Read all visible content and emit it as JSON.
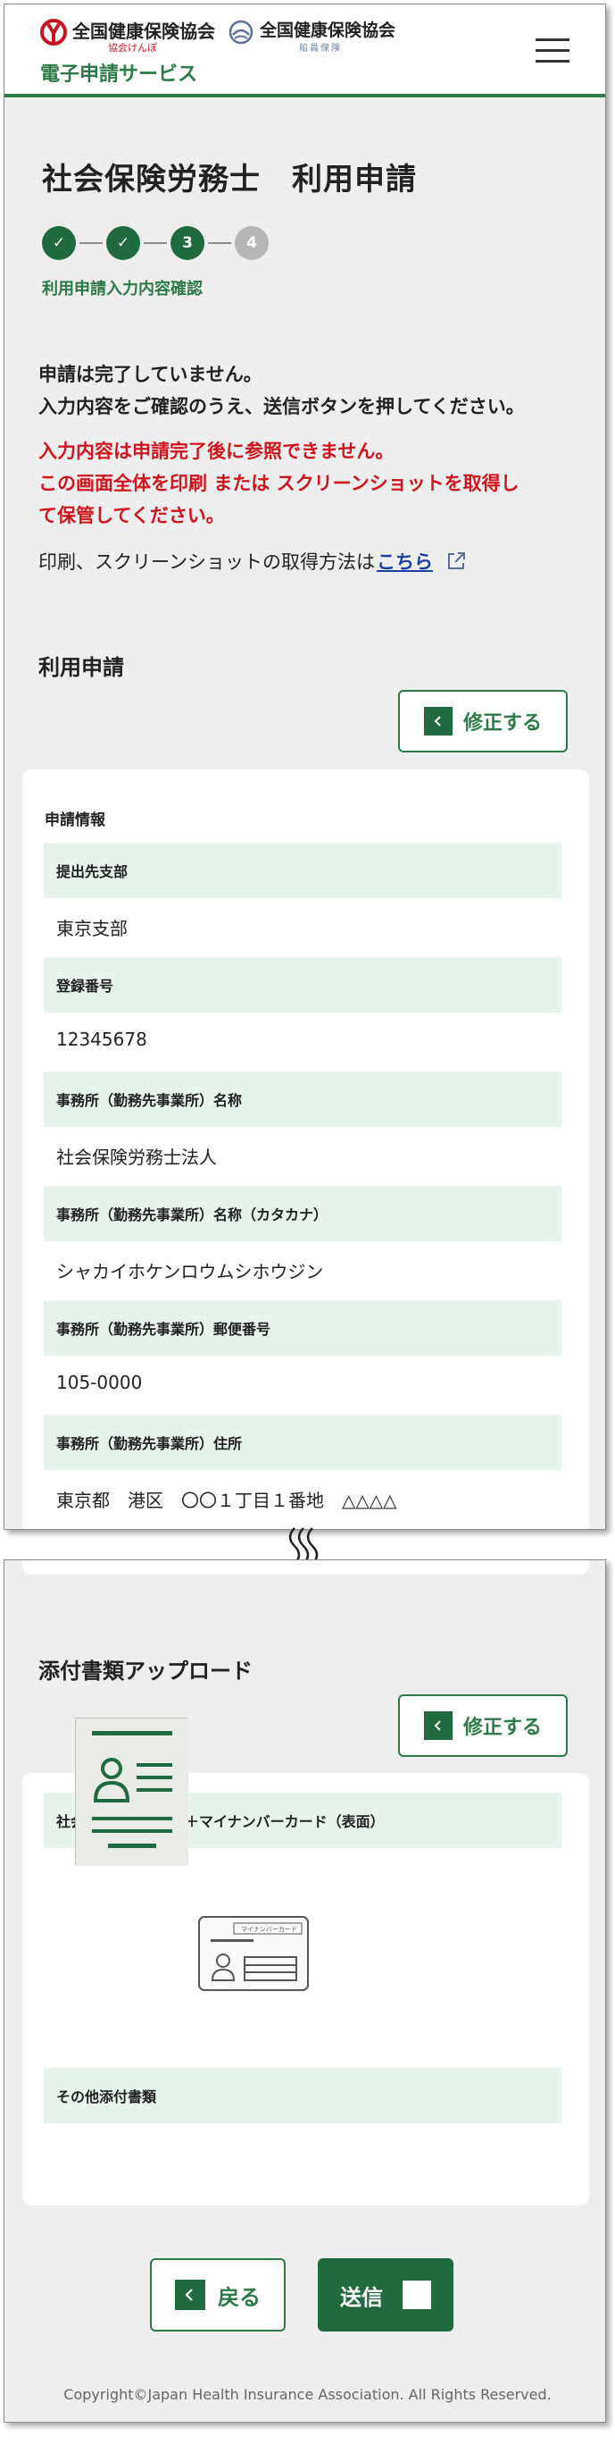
{
  "header": {
    "logo1_title": "全国健康保険協会",
    "logo1_sub": "協会けんぽ",
    "logo2_title": "全国健康保険協会",
    "logo2_sub": "船員保険",
    "service_name": "電子申請サービス",
    "menu_icon": "hamburger-icon"
  },
  "page": {
    "title": "社会保険労務士　利用申請",
    "steps": [
      {
        "label": "✓",
        "state": "done"
      },
      {
        "label": "✓",
        "state": "done"
      },
      {
        "label": "3",
        "state": "current"
      },
      {
        "label": "4",
        "state": "todo"
      }
    ],
    "step_label": "利用申請入力内容確認"
  },
  "notice": {
    "line1": "申請は完了していません。",
    "line2": "入力内容をご確認のうえ、送信ボタンを押してください。"
  },
  "warning": {
    "line1": "入力内容は申請完了後に参照できません。",
    "line2": "この画面全体を印刷 または スクリーンショットを取得し",
    "line3": "て保管してください。"
  },
  "howto": {
    "text": "印刷、スクリーンショットの取得方法は",
    "link": "こちら"
  },
  "application": {
    "section_title": "利用申請",
    "edit_label": "修正する",
    "card_heading": "申請情報",
    "fields": [
      {
        "label": "提出先支部",
        "value": "東京支部"
      },
      {
        "label": "登録番号",
        "value": "12345678"
      },
      {
        "label": "事務所（勤務先事業所）名称",
        "value": "社会保険労務士法人"
      },
      {
        "label": "事務所（勤務先事業所）名称（カタカナ）",
        "value": "シャカイホケンロウムシホウジン"
      },
      {
        "label": "事務所（勤務先事業所）郵便番号",
        "value": "105-0000"
      },
      {
        "label": "事務所（勤務先事業所）住所",
        "value": "東京都　港区　〇〇１丁目１番地　△△△△"
      }
    ]
  },
  "attachments": {
    "section_title": "添付書類アップロード",
    "edit_label": "修正する",
    "label1": "社会保険労務士証票＋マイナンバーカード（表面）",
    "label2": "その他添付書類",
    "card_text": "マイナンバーカード"
  },
  "actions": {
    "back_label": "戻る",
    "send_label": "送信"
  },
  "footer": {
    "copyright": "Copyright©Japan Health Insurance Association. All Rights Reserved."
  },
  "colors": {
    "brand_green": "#2b7a48",
    "dark_green": "#1f6b3f",
    "field_bg": "#e6f4ec",
    "warning_red": "#d0141c",
    "link_blue": "#1a3fa8"
  }
}
